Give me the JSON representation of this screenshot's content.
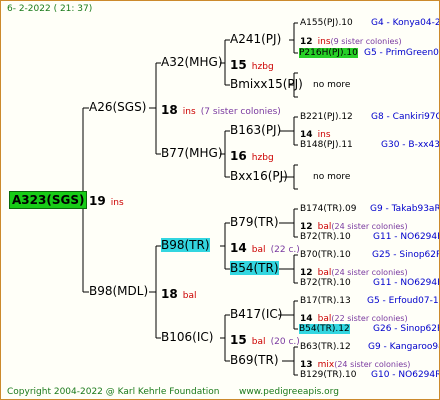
{
  "header": {
    "date": "6-  2-2022 ( 21:  37)"
  },
  "footer": {
    "copyright": "Copyright 2004-2022 @ Karl Kehrle Foundation",
    "site": "www.pedigreeapis.org"
  },
  "colors": {
    "accent_green": "#17cc17",
    "highlight_cyan": "#33d6e0",
    "link_blue": "#0000cc",
    "subline_red": "#cc0000",
    "border": "#cc8a2c"
  },
  "root": {
    "label": "A323(SGS)",
    "num": "19",
    "suffix": "ins"
  },
  "gen1": [
    {
      "label": "A26(SGS)",
      "num": "18",
      "suffix": "ins",
      "note": "(7 sister colonies)"
    },
    {
      "label": "B98(MDL)",
      "num": "18",
      "suffix": "bal"
    }
  ],
  "gen2": [
    {
      "label": "A32(MHG)",
      "num": "15",
      "suffix": "hzbg"
    },
    {
      "label": "B77(MHG)",
      "num": "16",
      "suffix": "hzbg"
    },
    {
      "label": "B98(TR)",
      "num": "14",
      "suffix": "bal",
      "note": "(22 c.)"
    },
    {
      "label": "B106(IC)",
      "num": "15",
      "suffix": "bal",
      "note": "(20 c.)"
    }
  ],
  "gen3": [
    {
      "label": "A241(PJ)"
    },
    {
      "label": "Bmixx15(PJ)"
    },
    {
      "label": "B163(PJ)"
    },
    {
      "label": "Bxx16(PJ)"
    },
    {
      "label": "B79(TR)"
    },
    {
      "label": "B54(TR)"
    },
    {
      "label": "B417(IC)"
    },
    {
      "label": "B69(TR)"
    }
  ],
  "gen4": [
    {
      "father": "A155(PJ).10",
      "code": "G4 - Konya04-2",
      "num": "12",
      "suffix": "ins",
      "note": "(9 sister colonies)",
      "mother": "P216H(PJ).10",
      "mcode": "G5 - PrimGreen00"
    },
    {
      "more": "no more"
    },
    {
      "father": "B221(PJ).12",
      "code": "G8 - Cankiri97Q",
      "num": "14",
      "suffix": "ins",
      "mother": "B148(PJ).11",
      "mcode": "G30 - B-xx43"
    },
    {
      "more": "no more"
    },
    {
      "father": "B174(TR).09",
      "code": "G9 - Takab93aR",
      "num": "12",
      "suffix": "bal",
      "note": "(24 sister colonies)",
      "mother": "B72(TR).10",
      "mcode": "G11 - NO6294R"
    },
    {
      "father": "B70(TR).10",
      "code": "G25 - Sinop62R",
      "num": "12",
      "suffix": "bal",
      "note": "(24 sister colonies)",
      "mother": "B72(TR).10",
      "mcode": "G11 - NO6294R"
    },
    {
      "father": "B17(TR).13",
      "code": "G5 - Erfoud07-1Q",
      "num": "14",
      "suffix": "bal",
      "note": "(22 sister colonies)",
      "mother": "B54(TR).12",
      "mcode": "G26 - Sinop62R"
    },
    {
      "father": "B63(TR).12",
      "code": "G9 - Kangaroo98R",
      "num": "13",
      "suffix": "mix",
      "note": "(24 sister colonies)",
      "mother": "B129(TR).10",
      "mcode": "G10 - NO6294R"
    }
  ]
}
